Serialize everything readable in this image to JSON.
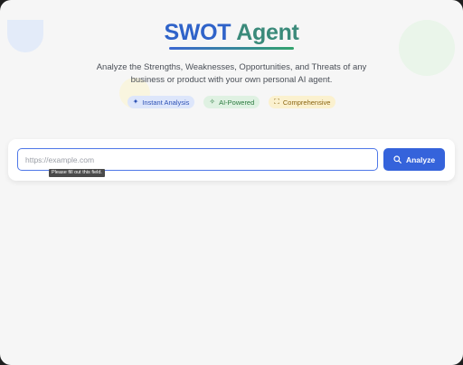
{
  "header": {
    "title_word1": "SWOT",
    "title_word2": "Agent",
    "subtitle": "Analyze the Strengths, Weaknesses, Opportunities, and Threats of any business or product with your own personal AI agent."
  },
  "badges": [
    {
      "label": "Instant Analysis",
      "icon": "sparkle-icon"
    },
    {
      "label": "AI-Powered",
      "icon": "sparkles-icon"
    },
    {
      "label": "Comprehensive",
      "icon": "expand-icon"
    }
  ],
  "form": {
    "url_placeholder": "https://example.com",
    "url_value": "",
    "analyze_label": "Analyze",
    "validation_tooltip": "Please fill out this field."
  },
  "colors": {
    "accent": "#3563db",
    "title_blue": "#2f63c9",
    "title_green": "#3a8a7a"
  }
}
